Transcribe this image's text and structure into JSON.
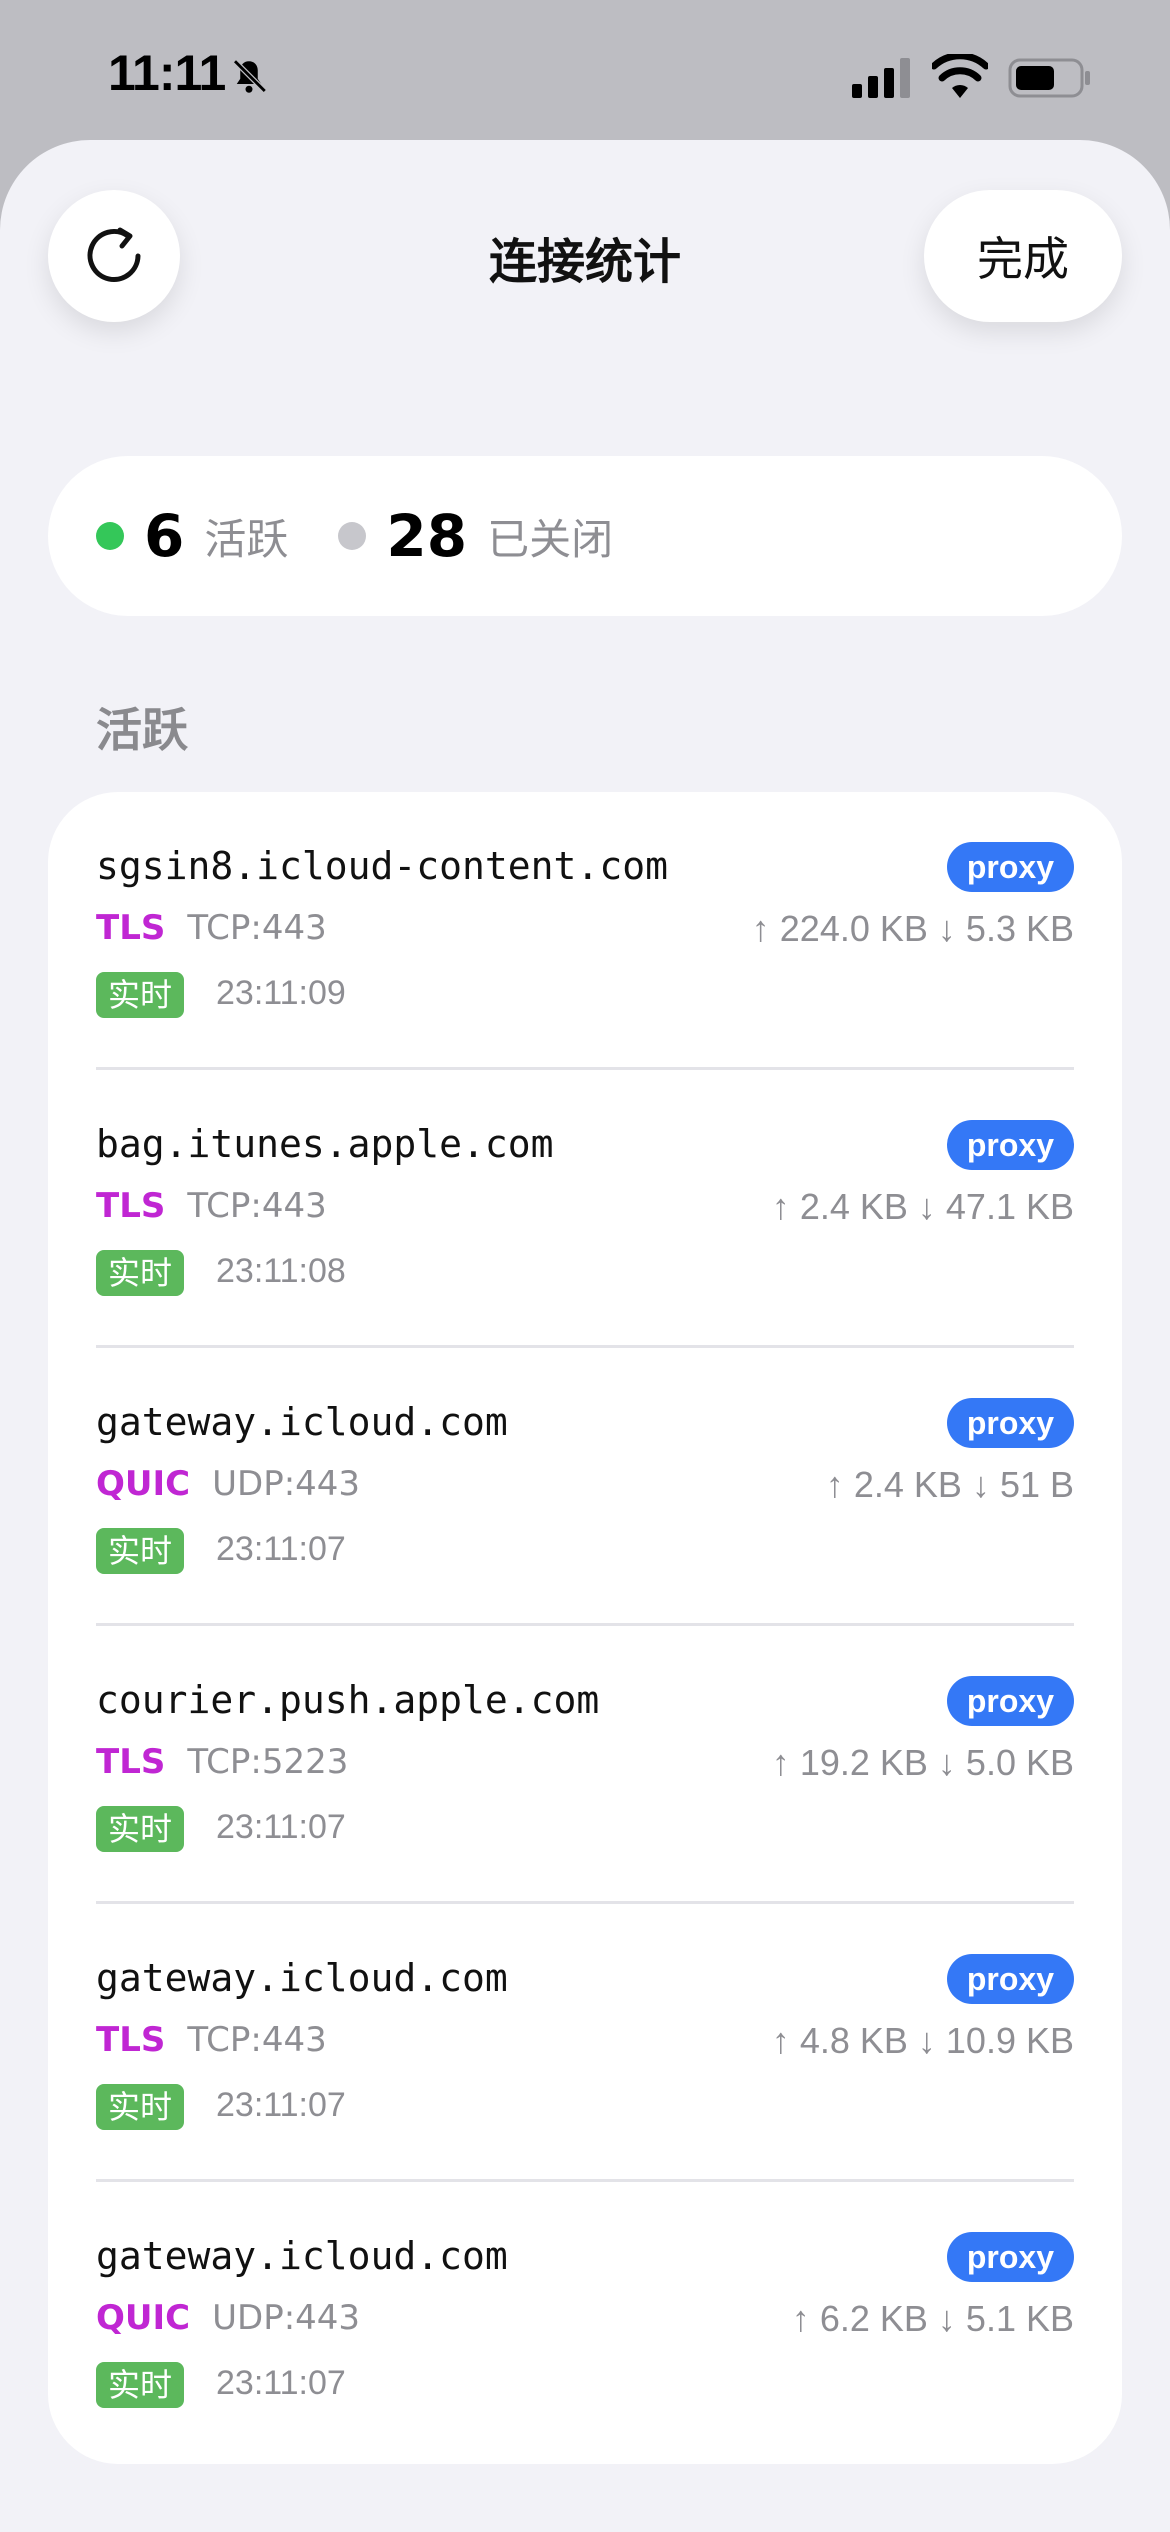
{
  "status_bar": {
    "time": "11:11",
    "icons": [
      "bell-slash-icon",
      "cellular-signal-icon",
      "wifi-icon",
      "battery-icon"
    ]
  },
  "header": {
    "title": "连接统计",
    "done_label": "完成",
    "refresh_icon": "refresh-icon"
  },
  "summary": {
    "active_count": "6",
    "active_label": "活跃",
    "closed_count": "28",
    "closed_label": "已关闭",
    "active_color": "#34c759",
    "closed_color": "#c7c7cc"
  },
  "section": {
    "label": "活跃"
  },
  "connections": [
    {
      "host": "sgsin8.icloud-content.com",
      "rule": "proxy",
      "protocol": "TLS",
      "port": "TCP:443",
      "up": "↑ 224.0 KB",
      "down": "↓ 5.3 KB",
      "badge": "实时",
      "time": "23:11:09"
    },
    {
      "host": "bag.itunes.apple.com",
      "rule": "proxy",
      "protocol": "TLS",
      "port": "TCP:443",
      "up": "↑ 2.4 KB",
      "down": "↓ 47.1 KB",
      "badge": "实时",
      "time": "23:11:08"
    },
    {
      "host": "gateway.icloud.com",
      "rule": "proxy",
      "protocol": "QUIC",
      "port": "UDP:443",
      "up": "↑ 2.4 KB",
      "down": "↓ 51 B",
      "badge": "实时",
      "time": "23:11:07"
    },
    {
      "host": "courier.push.apple.com",
      "rule": "proxy",
      "protocol": "TLS",
      "port": "TCP:5223",
      "up": "↑ 19.2 KB",
      "down": "↓ 5.0 KB",
      "badge": "实时",
      "time": "23:11:07"
    },
    {
      "host": "gateway.icloud.com",
      "rule": "proxy",
      "protocol": "TLS",
      "port": "TCP:443",
      "up": "↑ 4.8 KB",
      "down": "↓ 10.9 KB",
      "badge": "实时",
      "time": "23:11:07"
    },
    {
      "host": "gateway.icloud.com",
      "rule": "proxy",
      "protocol": "QUIC",
      "port": "UDP:443",
      "up": "↑ 6.2 KB",
      "down": "↓ 5.1 KB",
      "badge": "实时",
      "time": "23:11:07"
    }
  ],
  "colors": {
    "rule_badge": "#3478f6",
    "protocol": "#c026d3",
    "live_badge": "#5cb85c"
  }
}
